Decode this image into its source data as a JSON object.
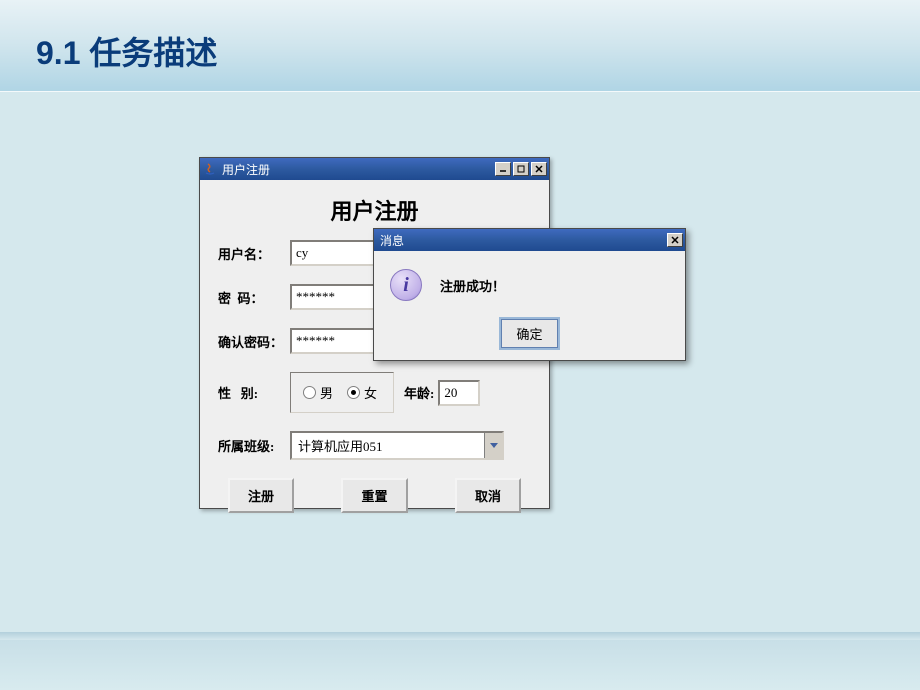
{
  "slide": {
    "title": "9.1 任务描述"
  },
  "window": {
    "title": "用户注册",
    "heading": "用户注册",
    "labels": {
      "username": "用户名：",
      "password": "密  码：",
      "confirm": "确认密码：",
      "gender": "性   别:",
      "age": "年龄:",
      "class": "所属班级:"
    },
    "values": {
      "username": "cy",
      "password": "******",
      "confirm": "******",
      "gender_male": "男",
      "gender_female": "女",
      "gender_selected": "female",
      "age": "20",
      "class": "计算机应用051"
    },
    "buttons": {
      "register": "注册",
      "reset": "重置",
      "cancel": "取消"
    }
  },
  "dialog": {
    "title": "消息",
    "message": "注册成功！",
    "ok": "确定"
  }
}
